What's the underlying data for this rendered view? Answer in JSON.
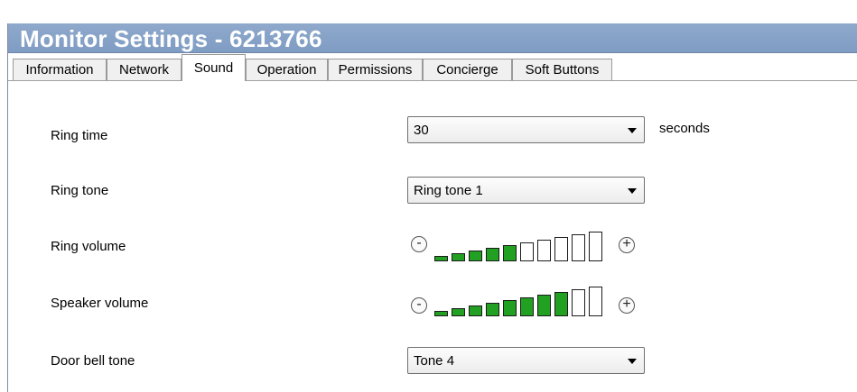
{
  "window": {
    "title": "Monitor Settings - 6213766"
  },
  "tabs": [
    {
      "label": "Information"
    },
    {
      "label": "Network"
    },
    {
      "label": "Sound",
      "active": true
    },
    {
      "label": "Operation"
    },
    {
      "label": "Permissions"
    },
    {
      "label": "Concierge"
    },
    {
      "label": "Soft Buttons"
    }
  ],
  "sound": {
    "ring_time": {
      "label": "Ring time",
      "value": "30",
      "unit": "seconds"
    },
    "ring_tone": {
      "label": "Ring tone",
      "value": "Ring tone 1"
    },
    "ring_volume": {
      "label": "Ring volume",
      "level": 5,
      "max": 10,
      "minus": "-",
      "plus": "+"
    },
    "speaker_volume": {
      "label": "Speaker volume",
      "level": 8,
      "max": 10,
      "minus": "-",
      "plus": "+"
    },
    "door_bell_tone": {
      "label": "Door bell tone",
      "value": "Tone 4"
    }
  },
  "colors": {
    "bar_on": "#21a021",
    "bar_off": "#ffffff",
    "titlebar": "#7f9cc3"
  }
}
